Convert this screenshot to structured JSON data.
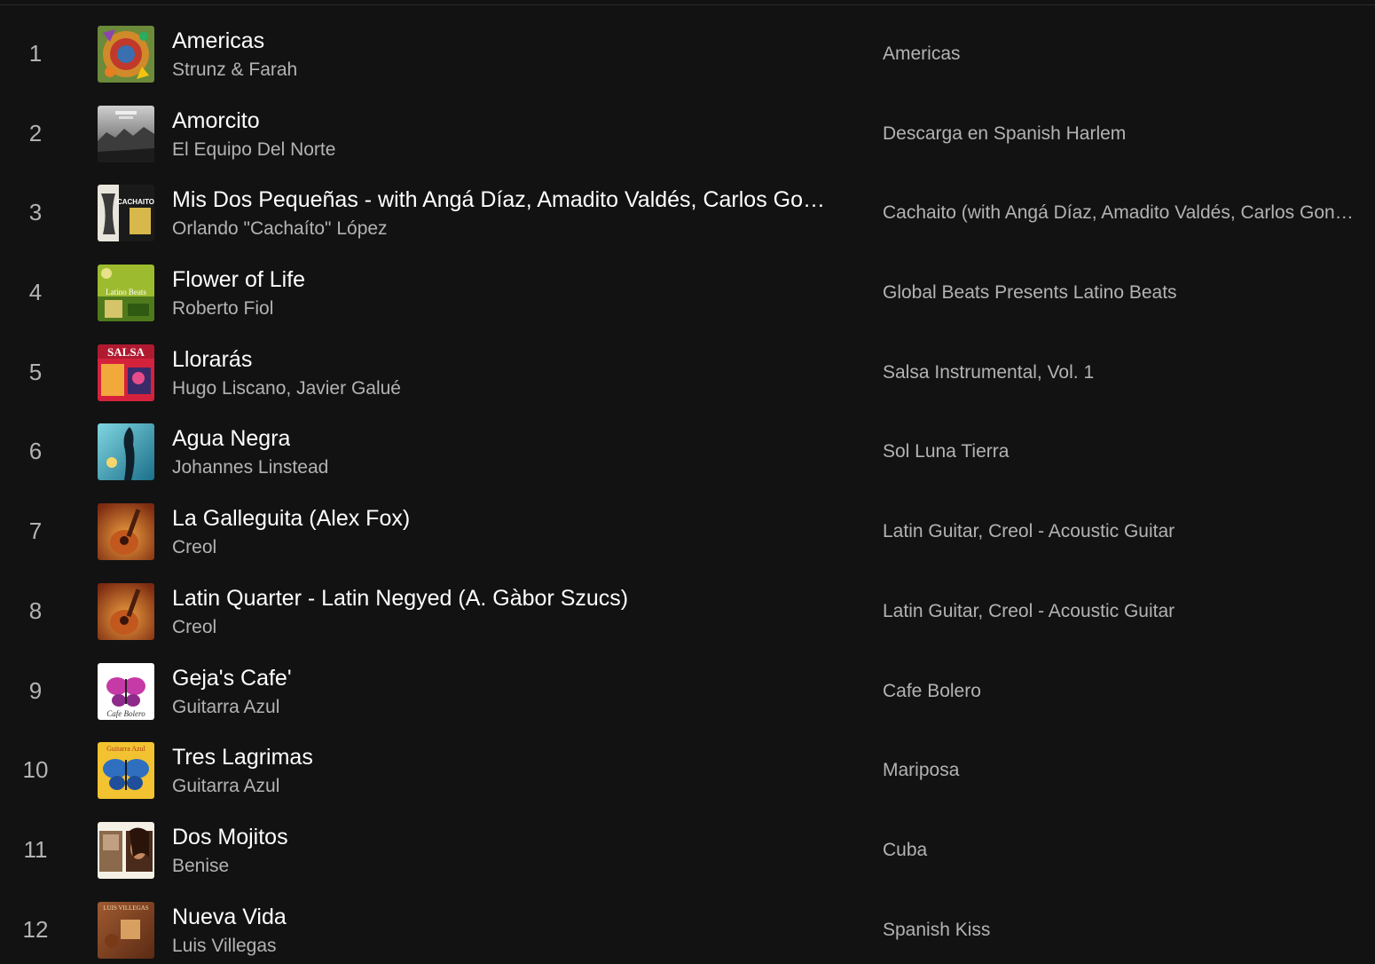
{
  "tracks": [
    {
      "number": "1",
      "title": "Americas",
      "artist": "Strunz & Farah",
      "album": "Americas",
      "cover_icon": "album-cover-americas"
    },
    {
      "number": "2",
      "title": "Amorcito",
      "artist": "El Equipo Del Norte",
      "album": "Descarga en Spanish Harlem",
      "cover_icon": "album-cover-descarga"
    },
    {
      "number": "3",
      "title": "Mis Dos Pequeñas - with Angá Díaz, Amadito Valdés, Carlos Go…",
      "artist": "Orlando \"Cachaíto\" López",
      "album": "Cachaito (with Angá Díaz, Amadito Valdés, Carlos Gon…",
      "cover_icon": "album-cover-cachaito",
      "cover_text": "CACHAITO"
    },
    {
      "number": "4",
      "title": "Flower of Life",
      "artist": "Roberto Fiol",
      "album": "Global Beats Presents Latino Beats",
      "cover_icon": "album-cover-latino-beats",
      "cover_text": "Latino Beats"
    },
    {
      "number": "5",
      "title": "Llorarás",
      "artist": "Hugo Liscano, Javier Galué",
      "album": "Salsa Instrumental, Vol. 1",
      "cover_icon": "album-cover-salsa",
      "cover_text": "SALSA"
    },
    {
      "number": "6",
      "title": "Agua Negra",
      "artist": "Johannes Linstead",
      "album": "Sol Luna Tierra",
      "cover_icon": "album-cover-sol-luna-tierra"
    },
    {
      "number": "7",
      "title": "La Galleguita (Alex Fox)",
      "artist": "Creol",
      "album": "Latin Guitar, Creol - Acoustic Guitar",
      "cover_icon": "album-cover-latin-guitar"
    },
    {
      "number": "8",
      "title": "Latin Quarter - Latin Negyed (A. Gàbor Szucs)",
      "artist": "Creol",
      "album": "Latin Guitar, Creol - Acoustic Guitar",
      "cover_icon": "album-cover-latin-guitar"
    },
    {
      "number": "9",
      "title": "Geja's Cafe'",
      "artist": "Guitarra Azul",
      "album": "Cafe Bolero",
      "cover_icon": "album-cover-cafe-bolero",
      "cover_text": "Cafe Bolero"
    },
    {
      "number": "10",
      "title": "Tres Lagrimas",
      "artist": "Guitarra Azul",
      "album": "Mariposa",
      "cover_icon": "album-cover-mariposa",
      "cover_text": "Guitarra Azul"
    },
    {
      "number": "11",
      "title": "Dos Mojitos",
      "artist": "Benise",
      "album": "Cuba",
      "cover_icon": "album-cover-cuba"
    },
    {
      "number": "12",
      "title": "Nueva Vida",
      "artist": "Luis Villegas",
      "album": "Spanish Kiss",
      "cover_icon": "album-cover-spanish-kiss",
      "cover_text": "LUIS VILLEGAS"
    }
  ]
}
